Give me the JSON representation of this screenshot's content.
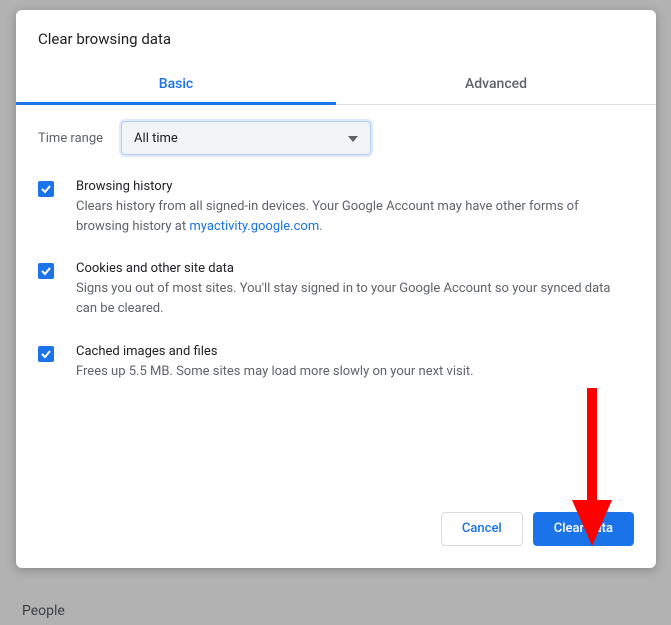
{
  "background": {
    "people_label": "People"
  },
  "dialog": {
    "title": "Clear browsing data",
    "tabs": {
      "basic": "Basic",
      "advanced": "Advanced"
    },
    "time_range": {
      "label": "Time range",
      "value": "All time"
    },
    "items": [
      {
        "title": "Browsing history",
        "desc_prefix": "Clears history from all signed-in devices. Your Google Account may have other forms of browsing history at ",
        "desc_link": "myactivity.google.com",
        "desc_suffix": "."
      },
      {
        "title": "Cookies and other site data",
        "desc": "Signs you out of most sites. You'll stay signed in to your Google Account so your synced data can be cleared."
      },
      {
        "title": "Cached images and files",
        "desc": "Frees up 5.5 MB. Some sites may load more slowly on your next visit."
      }
    ],
    "buttons": {
      "cancel": "Cancel",
      "clear": "Clear data"
    }
  }
}
